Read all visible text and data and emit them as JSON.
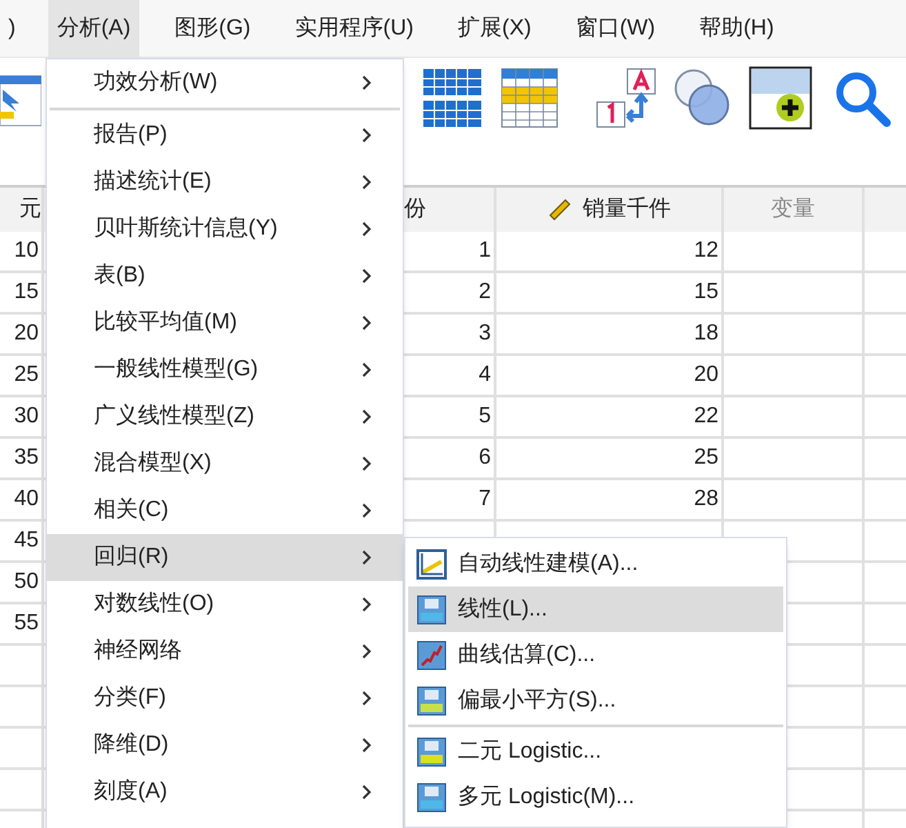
{
  "menu_bar": [
    {
      "label": ")",
      "selected": false
    },
    {
      "label": "分析(A)",
      "selected": true
    },
    {
      "label": "图形(G)",
      "selected": false
    },
    {
      "label": "实用程序(U)",
      "selected": false
    },
    {
      "label": "扩展(X)",
      "selected": false
    },
    {
      "label": "窗口(W)",
      "selected": false
    },
    {
      "label": "帮助(H)",
      "selected": false
    }
  ],
  "table": {
    "columns": [
      {
        "header": "元",
        "kind": "data",
        "values": [
          "10",
          "15",
          "20",
          "25",
          "30",
          "35",
          "40",
          "45",
          "50",
          "55"
        ]
      },
      {
        "kind": "hidden"
      },
      {
        "header": "份",
        "kind": "data",
        "values": [
          "1",
          "2",
          "3",
          "4",
          "5",
          "6",
          "7"
        ]
      },
      {
        "header": "销量千件",
        "kind": "scale",
        "values": [
          "12",
          "15",
          "18",
          "20",
          "22",
          "25",
          "28"
        ]
      },
      {
        "header": "变量",
        "kind": "empty"
      },
      {
        "kind": "blank"
      }
    ]
  },
  "analyze_menu": {
    "items": [
      {
        "label": "功效分析(W)",
        "selected": false,
        "separator_after": true
      },
      {
        "label": "报告(P)",
        "selected": false,
        "separator_after": false
      },
      {
        "label": "描述统计(E)",
        "selected": false,
        "separator_after": false
      },
      {
        "label": "贝叶斯统计信息(Y)",
        "selected": false,
        "separator_after": false
      },
      {
        "label": "表(B)",
        "selected": false,
        "separator_after": false
      },
      {
        "label": "比较平均值(M)",
        "selected": false,
        "separator_after": false
      },
      {
        "label": "一般线性模型(G)",
        "selected": false,
        "separator_after": false
      },
      {
        "label": "广义线性模型(Z)",
        "selected": false,
        "separator_after": false
      },
      {
        "label": "混合模型(X)",
        "selected": false,
        "separator_after": false
      },
      {
        "label": "相关(C)",
        "selected": false,
        "separator_after": false
      },
      {
        "label": "回归(R)",
        "selected": true,
        "separator_after": false
      },
      {
        "label": "对数线性(O)",
        "selected": false,
        "separator_after": false
      },
      {
        "label": "神经网络",
        "selected": false,
        "separator_after": false
      },
      {
        "label": "分类(F)",
        "selected": false,
        "separator_after": false
      },
      {
        "label": "降维(D)",
        "selected": false,
        "separator_after": false
      },
      {
        "label": "刻度(A)",
        "selected": false,
        "separator_after": false
      }
    ]
  },
  "regression_submenu": {
    "items": [
      {
        "label": "自动线性建模(A)...",
        "kind": "auto",
        "selected": false,
        "separator_after": false
      },
      {
        "label": "线性(L)...",
        "kind": "lin",
        "selected": true,
        "separator_after": false
      },
      {
        "label": "曲线估算(C)...",
        "kind": "curve",
        "selected": false,
        "separator_after": false
      },
      {
        "label": "偏最小平方(S)...",
        "kind": "pls",
        "selected": false,
        "separator_after": true
      },
      {
        "label": "二元 Logistic...",
        "kind": "log",
        "selected": false,
        "separator_after": false
      },
      {
        "label": "多元 Logistic(M)...",
        "kind": "mlog",
        "selected": false,
        "separator_after": false
      }
    ]
  }
}
